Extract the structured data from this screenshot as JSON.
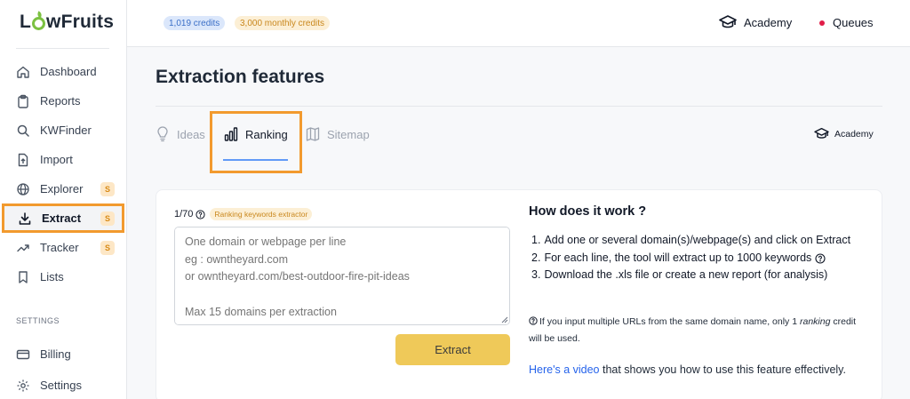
{
  "app": {
    "logo": {
      "part1": "L",
      "part2": "wFruits"
    }
  },
  "sidebar": {
    "items": [
      {
        "label": "Dashboard",
        "icon": "home-icon"
      },
      {
        "label": "Reports",
        "icon": "clipboard-icon"
      },
      {
        "label": "KWFinder",
        "icon": "search-icon"
      },
      {
        "label": "Import",
        "icon": "upload-icon"
      },
      {
        "label": "Explorer",
        "icon": "globe-icon",
        "badge": "S"
      },
      {
        "label": "Extract",
        "icon": "download-icon",
        "badge": "S",
        "active": true
      },
      {
        "label": "Tracker",
        "icon": "trend-icon",
        "badge": "S"
      },
      {
        "label": "Lists",
        "icon": "bookmark-icon"
      }
    ],
    "settings_label": "SETTINGS",
    "settings_items": [
      {
        "label": "Billing",
        "icon": "card-icon"
      },
      {
        "label": "Settings",
        "icon": "gear-icon"
      }
    ]
  },
  "topbar": {
    "credits": "1,019 credits",
    "monthly_credits": "3,000 monthly credits",
    "academy": "Academy",
    "queues": "Queues"
  },
  "main": {
    "title": "Extraction features",
    "tabs": [
      {
        "label": "Ideas",
        "icon": "lightbulb-icon"
      },
      {
        "label": "Ranking",
        "icon": "bar-chart-icon",
        "active": true
      },
      {
        "label": "Sitemap",
        "icon": "map-icon"
      }
    ],
    "academy_link": "Academy"
  },
  "form": {
    "counter": "1/70",
    "badge": "Ranking keywords extractor",
    "placeholder": "One domain or webpage per line\neg : owntheyard.com\nor owntheyard.com/best-outdoor-fire-pit-ideas\n\n Max 15 domains per extraction",
    "value": "",
    "extract_label": "Extract"
  },
  "help": {
    "title": "How does it work ?",
    "steps": [
      "Add one or several domain(s)/webpage(s) and click on Extract",
      "For each line, the tool will extract up to 1000 keywords",
      "Download the .xls file or create a new report (for analysis)"
    ],
    "note_before": "If you input multiple URLs from the same domain name, only 1 ",
    "note_em": "ranking",
    "note_after": " credit will be used.",
    "video_link": "Here's a video",
    "video_rest": " that shows you how to use this feature effectively."
  },
  "colors": {
    "accent_green": "#7cc142",
    "highlight_orange": "#f29a2e",
    "extract_button": "#efc959",
    "link_blue": "#2563eb",
    "queue_dot": "#e11d48"
  }
}
